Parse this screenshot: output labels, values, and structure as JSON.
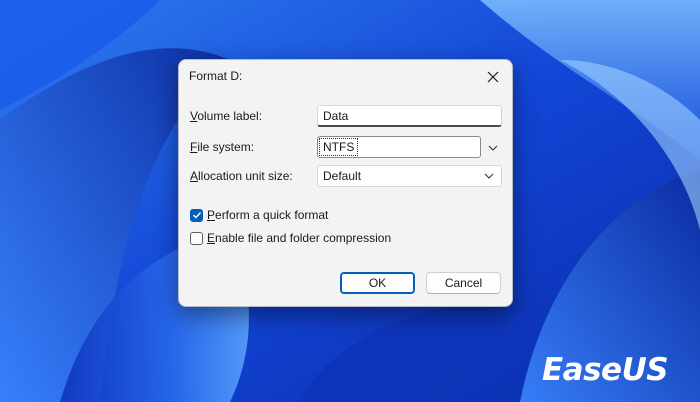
{
  "dialog": {
    "title": "Format D:",
    "volume_label": {
      "label_first": "V",
      "label_rest": "olume label:",
      "value": "Data"
    },
    "file_system": {
      "label_first": "F",
      "label_rest": "ile system:",
      "value": "NTFS"
    },
    "allocation": {
      "label_first": "A",
      "label_rest": "llocation unit size:",
      "value": "Default"
    },
    "quick_format": {
      "label_first": "P",
      "label_rest": "erform a quick format",
      "checked": true
    },
    "compression": {
      "label_first": "E",
      "label_rest": "nable file and folder compression",
      "checked": false
    },
    "ok_label": "OK",
    "cancel_label": "Cancel"
  },
  "brand": {
    "logo_text": "EaseUS"
  },
  "colors": {
    "accent": "#005fb8",
    "wallpaper": "#0a3fc4",
    "dialog_bg": "#f3f3f3"
  }
}
